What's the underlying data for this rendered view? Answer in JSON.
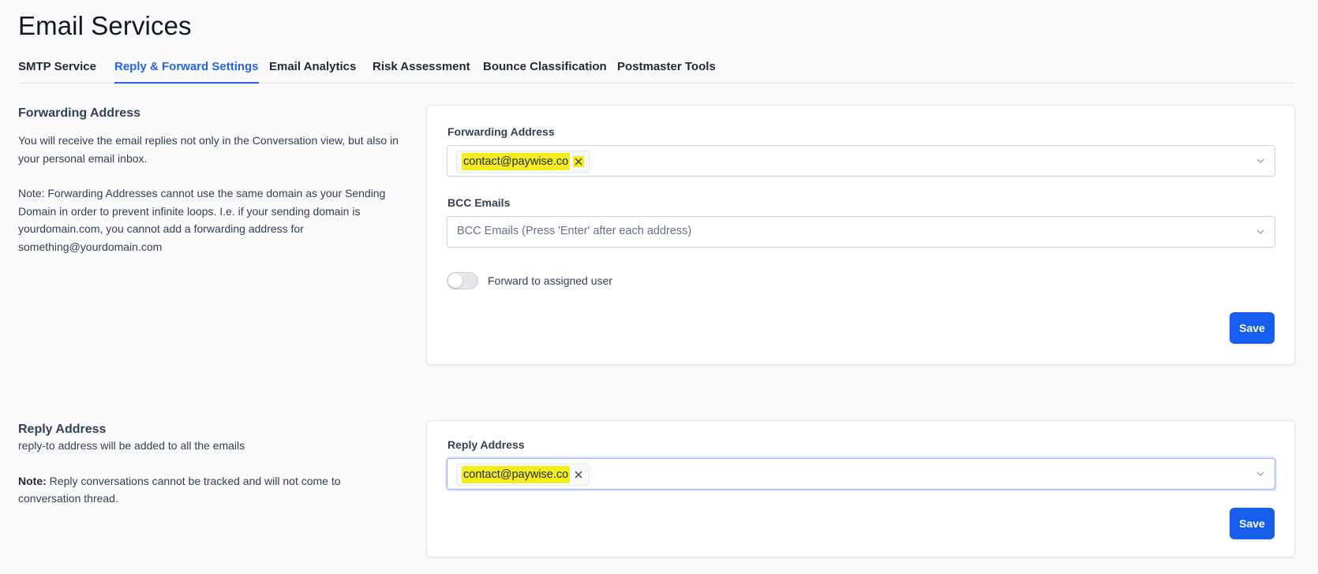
{
  "page": {
    "title": "Email Services"
  },
  "tabs": [
    {
      "label": "SMTP Service",
      "active": false
    },
    {
      "label": "Reply & Forward Settings",
      "active": true
    },
    {
      "label": "Email Analytics",
      "active": false
    },
    {
      "label": "Risk Assessment",
      "active": false
    },
    {
      "label": "Bounce Classification",
      "active": false
    },
    {
      "label": "Postmaster Tools",
      "active": false
    }
  ],
  "forwarding": {
    "section_title": "Forwarding Address",
    "description": "You will receive the email replies not only in the Conversation view, but also in your personal email inbox.",
    "note": "Note: Forwarding Addresses cannot use the same domain as your Sending Domain in order to prevent infinite loops. I.e. if your sending domain is yourdomain.com, you cannot add a forwarding address for something@yourdomain.com",
    "field_label": "Forwarding Address",
    "chip": "contact@paywise.co",
    "bcc_label": "BCC Emails",
    "bcc_placeholder": "BCC Emails (Press 'Enter' after each address)",
    "toggle_label": "Forward to assigned user",
    "toggle_on": false,
    "save_label": "Save"
  },
  "reply": {
    "section_title": "Reply Address",
    "description": "reply-to address will be added to all the emails",
    "note_label": "Note:",
    "note_text": " Reply conversations cannot be tracked and will not come to conversation thread.",
    "field_label": "Reply Address",
    "chip": "contact@paywise.co",
    "save_label": "Save"
  },
  "colors": {
    "accent": "#2463eb",
    "button": "#155eef",
    "highlight": "#f5ec1b"
  },
  "icons": {
    "chip_remove": "close-icon",
    "dropdown": "chevron-down-icon"
  }
}
